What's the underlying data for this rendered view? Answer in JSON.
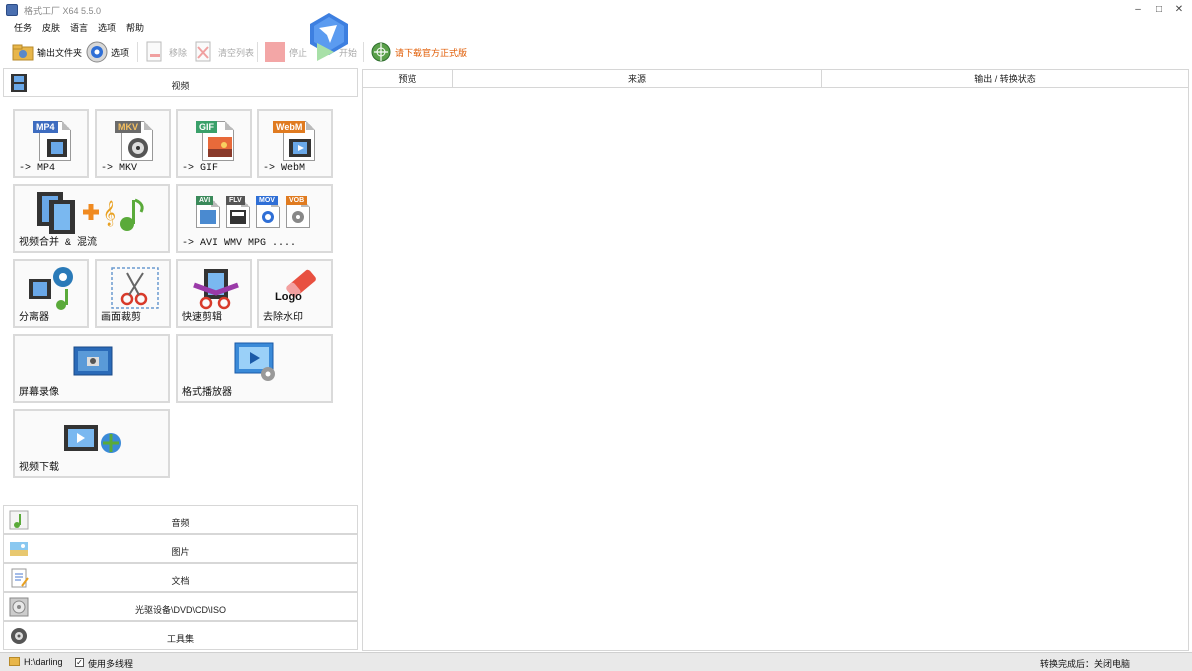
{
  "window": {
    "title": "格式工厂 X64 5.5.0"
  },
  "menu": [
    "任务",
    "皮肤",
    "语言",
    "选项",
    "帮助"
  ],
  "toolbar": {
    "output_folder": "输出文件夹",
    "options": "选项",
    "remove": "移除",
    "clear_list": "清空列表",
    "stop": "停止",
    "start": "开始",
    "download_notice": "请下载官方正式版"
  },
  "video_section": {
    "header": "视频",
    "tiles": [
      {
        "label": "-> MP4",
        "tag": "MP4"
      },
      {
        "label": "-> MKV",
        "tag": "MKV"
      },
      {
        "label": "-> GIF",
        "tag": "GIF"
      },
      {
        "label": "-> WebM",
        "tag": "WebM"
      },
      {
        "label": "视频合并 & 混流"
      },
      {
        "label": "-> AVI WMV MPG ....",
        "tags": [
          "AVI",
          "FLV",
          "MOV",
          "VOB"
        ]
      },
      {
        "label": "分离器"
      },
      {
        "label": "画面裁剪"
      },
      {
        "label": "快速剪辑"
      },
      {
        "label": "去除水印",
        "logo_text": "Logo"
      },
      {
        "label": "屏幕录像"
      },
      {
        "label": "格式播放器"
      },
      {
        "label": "视频下载"
      }
    ]
  },
  "categories": [
    {
      "label": "音频"
    },
    {
      "label": "图片"
    },
    {
      "label": "文档"
    },
    {
      "label": "光驱设备\\DVD\\CD\\ISO"
    },
    {
      "label": "工具集"
    }
  ],
  "table": {
    "columns": [
      "预览",
      "来源",
      "输出 / 转换状态"
    ]
  },
  "statusbar": {
    "path": "H:\\darling",
    "multithread": "使用多线程",
    "after_convert": "转换完成后：关闭电脑"
  },
  "colors": {
    "accent_blue": "#2f6fd6",
    "notice_orange": "#e05a00",
    "mp4": "#3d6cc0",
    "mkv": "#6b6b6b",
    "gif": "#3aa06a",
    "webm": "#e07b20"
  }
}
